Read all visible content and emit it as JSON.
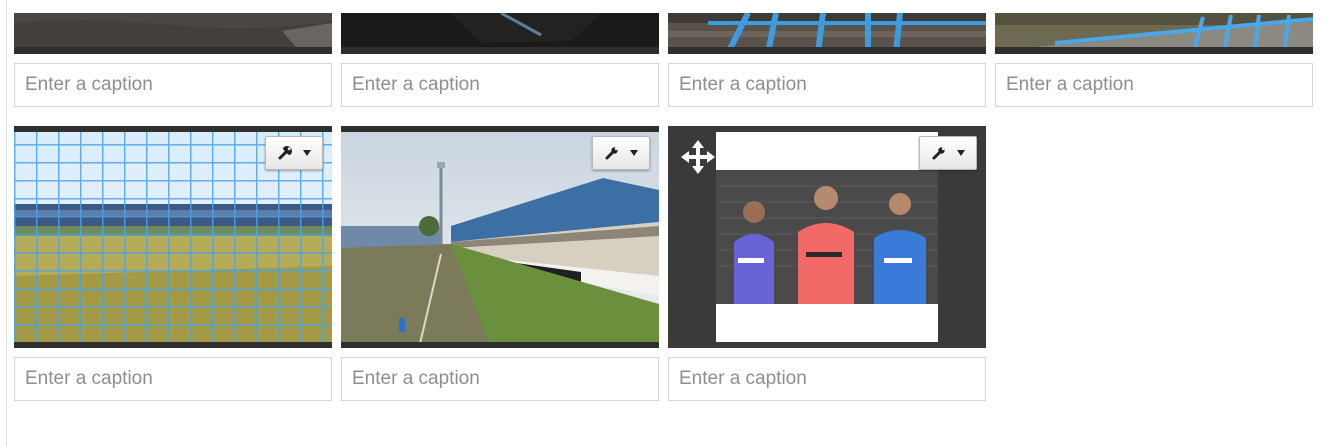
{
  "gallery": {
    "caption_placeholder": "Enter a caption",
    "top_row": [
      {
        "image": "dark-asphalt-ground",
        "caption": ""
      },
      {
        "image": "dark-stadium-corner",
        "caption": ""
      },
      {
        "image": "blue-stadium-railings",
        "caption": ""
      },
      {
        "image": "blue-terrace-railings",
        "caption": ""
      }
    ],
    "bottom_row": [
      {
        "image": "pitch-view-through-goal-net",
        "caption": "",
        "has_tools_button": true
      },
      {
        "image": "stadium-main-stand",
        "caption": "",
        "has_tools_button": true
      },
      {
        "image": "three-players-in-kits",
        "caption": "",
        "has_tools_button": true,
        "has_move_handle": true
      }
    ]
  },
  "icons": {
    "tools": "wrench-icon",
    "dropdown": "caret-down-icon",
    "move": "move-arrows-icon"
  },
  "colors": {
    "accent_blue": "#3d9be0",
    "frame_dark": "#3a3a3a",
    "field_border": "#d6d6d6",
    "placeholder_text": "#8e8e8e"
  }
}
